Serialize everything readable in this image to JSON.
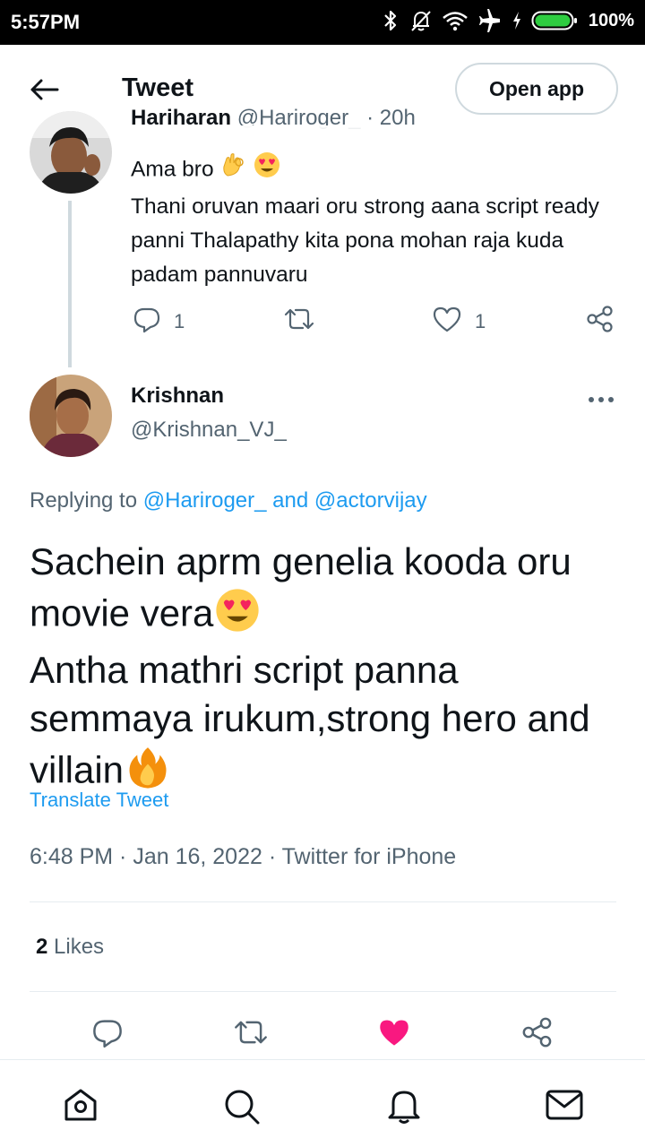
{
  "status_bar": {
    "time": "5:57PM",
    "battery": "100%",
    "icons": [
      "bluetooth-icon",
      "notifications-off-icon",
      "wifi-icon",
      "airplane-icon",
      "charging-icon",
      "battery-icon"
    ]
  },
  "header": {
    "title": "Tweet",
    "open_app_label": "Open app"
  },
  "previous_tweet": {
    "name_partial": "Hariharan",
    "handle_partial": "@Hariroger_ · 20h",
    "line1": "Ama bro",
    "text": "Thani oruvan maari oru strong aana script ready panni Thalapathy kita pona mohan raja kuda padam pannuvaru",
    "reply_count": "1",
    "like_count": "1",
    "emojis": [
      "ok-hand-emoji",
      "heart-eyes-emoji"
    ]
  },
  "main_tweet": {
    "author_name": "Krishnan",
    "author_handle": "@Krishnan_VJ_",
    "replying_prefix": "Replying to ",
    "replying_to_1": "@Hariroger_",
    "replying_and": " and ",
    "replying_to_2": "@actorvijay",
    "text_part1": "Sachein aprm genelia kooda oru movie vera",
    "text_part2": "Antha mathri script panna semmaya irukum,strong hero and villain",
    "translate_label": "Translate Tweet",
    "timestamp": "6:48 PM · Jan 16, 2022 · Twitter for iPhone",
    "likes_count": "2",
    "likes_label": " Likes"
  },
  "bottom_nav": {
    "items": [
      "home-icon",
      "search-icon",
      "notifications-icon",
      "messages-icon"
    ]
  },
  "colors": {
    "accent": "#1d9bf0",
    "like": "#f91880",
    "muted": "#536471",
    "text": "#0f1419"
  }
}
